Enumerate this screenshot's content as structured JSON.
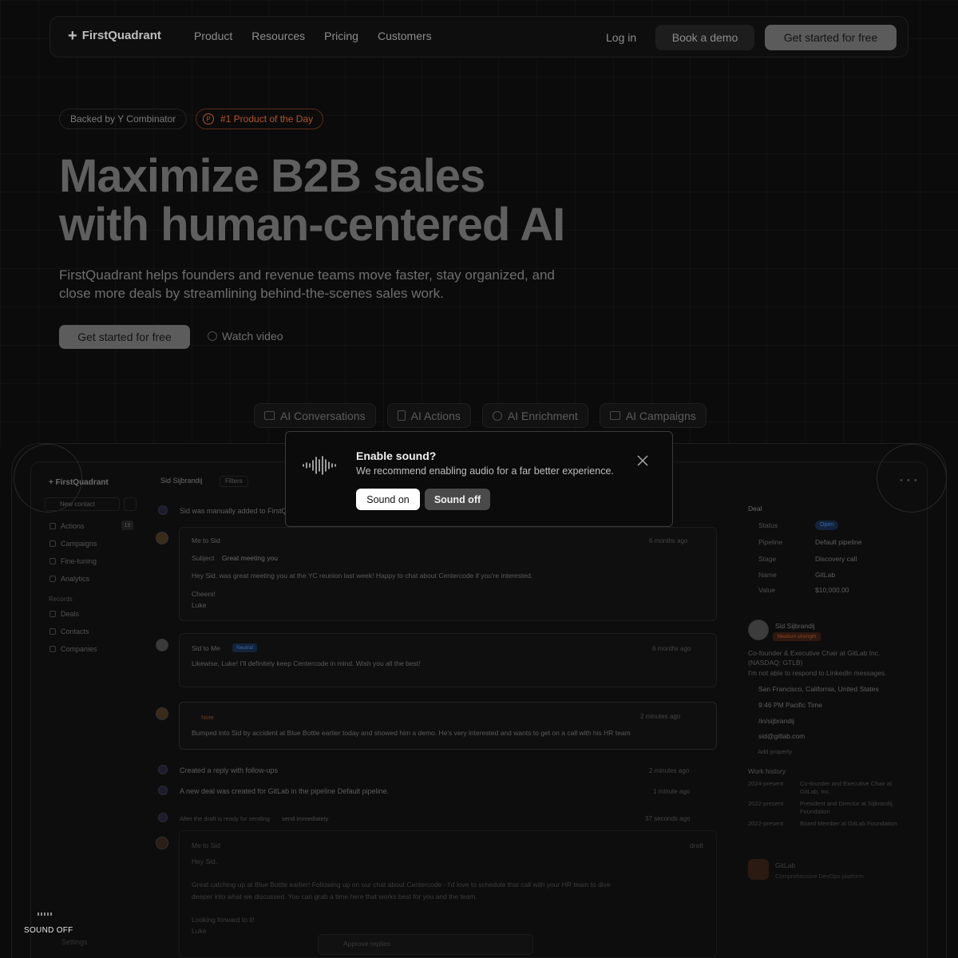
{
  "nav": {
    "brand": "FirstQuadrant",
    "links": [
      "Product",
      "Resources",
      "Pricing",
      "Customers"
    ],
    "login": "Log in",
    "book_demo": "Book a demo",
    "get_started": "Get started for free"
  },
  "hero": {
    "badge_yc": "Backed by Y Combinator",
    "badge_ph": "#1 Product of the Day",
    "title_line1": "Maximize B2B sales",
    "title_line2": "with human-centered AI",
    "subtitle": "FirstQuadrant helps founders and revenue teams move faster, stay organized, and close more deals by streamlining behind-the-scenes sales work.",
    "cta": "Get started for free",
    "watch_video": "Watch video"
  },
  "feature_tabs": [
    "AI Conversations",
    "AI Actions",
    "AI Enrichment",
    "AI Campaigns"
  ],
  "app": {
    "sidebar": {
      "brand": "FirstQuadrant",
      "new_contact": "New contact",
      "items": [
        "Actions",
        "Campaigns",
        "Fine-tuning",
        "Analytics"
      ],
      "actions_count": "19",
      "records_label": "Records",
      "records": [
        "Deals",
        "Contacts",
        "Companies"
      ],
      "settings": "Settings"
    },
    "conversation": {
      "contact_name": "Sid Sijbrandij",
      "filters": "Filters",
      "event1": "Sid was manually added to FirstQ",
      "email1": {
        "from_to": "Me  to  Sid",
        "time": "6 months ago",
        "subject_label": "Subject",
        "subject": "Great meeting you",
        "body1": "Hey Sid, was great meeting you at the YC reunion last week! Happy to chat about Centercode if you're interested.",
        "body2": "Cheers!",
        "body3": "Luke"
      },
      "email2": {
        "from_to": "Sid  to  Me",
        "tag": "Neutral",
        "time": "6 months ago",
        "body": "Likewise, Luke! I'll definitely keep Centercode in mind. Wish you all the best!"
      },
      "note": {
        "tag": "Note",
        "time": "2 minutes ago",
        "body": "Bumped into Sid by accident at Blue Bottle earlier today and showed him a demo. He's very interested and wants to get on a call with his HR team"
      },
      "event2": "Created a reply with follow-ups",
      "event2_time": "2 minutes ago",
      "event3": "A new deal was created for GitLab in the pipeline Default pipeline.",
      "event3_time": "1 minute ago",
      "event4": "After the draft is ready for sending",
      "event4_value": "send immediately",
      "event4_time": "37 seconds ago",
      "draft": {
        "from_to": "Me  to  Sid",
        "tag": "draft",
        "greeting": "Hey Sid,",
        "body1": "Great catching up at Blue Bottle earlier! Following up on our chat about Centercode - I'd love to schedule that call with your HR team to dive",
        "body2": "deeper into what we discussed. You can grab a time here that works best for you and the team.",
        "body3": "Looking forward to it!",
        "body4": "Luke"
      },
      "approve": "Approve replies"
    },
    "panel": {
      "deal_label": "Deal",
      "fields": [
        {
          "label": "Status",
          "value": "Open"
        },
        {
          "label": "Pipeline",
          "value": "Default pipeline"
        },
        {
          "label": "Stage",
          "value": "Discovery call"
        },
        {
          "label": "Name",
          "value": "GitLab"
        },
        {
          "label": "Value",
          "value": "$10,000.00"
        }
      ],
      "person_name": "Sid Sijbrandij",
      "strength": "Medium strength",
      "bio1": "Co-founder & Executive Chair at GitLab Inc.",
      "bio2": "(NASDAQ: GTLB)",
      "bio3": "I'm not able to respond to LinkedIn messages.",
      "location": "San Francisco, California, United States",
      "time": "9:46 PM Pacific Time",
      "linkedin": "/in/sijbrandij",
      "email": "sid@gitlab.com",
      "add_property": "Add property",
      "work_history_label": "Work history",
      "work_history": [
        {
          "years": "2024-present",
          "role": "Co-founder and Executive Chair at GitLab, Inc."
        },
        {
          "years": "2022-present",
          "role": "President and Director at Sijbrandij Foundation"
        },
        {
          "years": "2022-present",
          "role": "Board Member at GitLab Foundation"
        }
      ],
      "company_name": "GitLab",
      "company_desc": "Comprehensive DevOps platform"
    }
  },
  "modal": {
    "title": "Enable sound?",
    "description": "We recommend enabling audio for a far better experience.",
    "sound_on": "Sound on",
    "sound_off": "Sound off"
  },
  "sound_widget": {
    "label": "SOUND OFF"
  },
  "colors": {
    "background": "#0b0b0b",
    "modal_border": "#3a3a3a",
    "accent_orange": "#b2542f",
    "tag_blue": "#3b69a8"
  }
}
